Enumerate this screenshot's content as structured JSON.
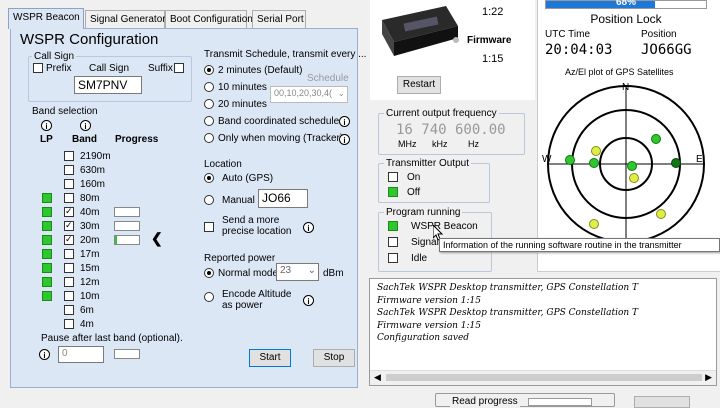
{
  "tabs": [
    "WSPR Beacon",
    "Signal Generator",
    "Boot Configuration",
    "Serial Port"
  ],
  "config": {
    "title": "WSPR Configuration",
    "call_sign_group": "Call Sign",
    "prefix_label": "Prefix",
    "call_sign_label": "Call Sign",
    "suffix_label": "Suffix",
    "call_sign_value": "SM7PNV",
    "band_selection_label": "Band selection",
    "lp_header": "LP",
    "band_header": "Band",
    "progress_header": "Progress",
    "bands": [
      {
        "name": "2190m",
        "lp": false,
        "checked": false
      },
      {
        "name": "630m",
        "lp": false,
        "checked": false
      },
      {
        "name": "160m",
        "lp": false,
        "checked": false
      },
      {
        "name": "80m",
        "lp": true,
        "checked": false
      },
      {
        "name": "40m",
        "lp": true,
        "checked": true
      },
      {
        "name": "30m",
        "lp": true,
        "checked": true
      },
      {
        "name": "20m",
        "lp": true,
        "checked": true
      },
      {
        "name": "17m",
        "lp": true,
        "checked": false
      },
      {
        "name": "15m",
        "lp": true,
        "checked": false
      },
      {
        "name": "12m",
        "lp": true,
        "checked": false
      },
      {
        "name": "10m",
        "lp": true,
        "checked": false
      },
      {
        "name": "6m",
        "lp": false,
        "checked": false
      },
      {
        "name": "4m",
        "lp": false,
        "checked": false
      }
    ],
    "progress_20m": 0.1,
    "pause_label": "Pause after last band (optional).",
    "pause_value": "0",
    "schedule_title": "Transmit Schedule, transmit every ...",
    "schedule_options": [
      "2 minutes (Default)",
      "10 minutes",
      "20 minutes",
      "Band coordinated schedule",
      "Only when moving (Tracker)"
    ],
    "schedule_label": "Schedule",
    "schedule_value": "00,10,20,30,4(",
    "location_title": "Location",
    "auto_gps_label": "Auto (GPS)",
    "manual_label": "Manual",
    "manual_value": "JO66",
    "precise_label": "Send a more precise location",
    "reported_power_title": "Reported power",
    "normal_mode_label": "Normal mode",
    "power_value": "23",
    "dbm_label": "dBm",
    "encode_alt_label": "Encode Altitude as power",
    "start_label": "Start",
    "stop_label": "Stop"
  },
  "device": {
    "time_value": "1:22",
    "firmware_label": "Firmware",
    "firmware_value": "1:15",
    "restart_label": "Restart"
  },
  "freq": {
    "title": "Current output frequency",
    "value": "16 740 600.00",
    "mhz": "MHz",
    "khz": "kHz",
    "hz": "Hz"
  },
  "tx_output": {
    "title": "Transmitter Output",
    "on_label": "On",
    "off_label": "Off"
  },
  "program": {
    "title": "Program running",
    "items": [
      "WSPR Beacon",
      "Signal",
      "Idle"
    ],
    "tooltip": "Information of the running software routine in the transmitter"
  },
  "gps": {
    "progress_text": "68%",
    "progress_value": 0.68,
    "position_lock": "Position Lock",
    "utc_label": "UTC Time",
    "utc_value": "20:04:03",
    "position_label": "Position",
    "position_value": "JO66GG",
    "plot_title": "Az/El plot of GPS Satellites",
    "n": "N",
    "w": "W",
    "e": "E"
  },
  "log": [
    "SachTek WSPR Desktop transmitter, GPS Constellation T",
    "Firmware version 1:15",
    "SachTek WSPR Desktop transmitter, GPS Constellation T",
    "Firmware version 1:15",
    "Configuration saved"
  ],
  "bottom": {
    "read_progress": "Read progress"
  }
}
